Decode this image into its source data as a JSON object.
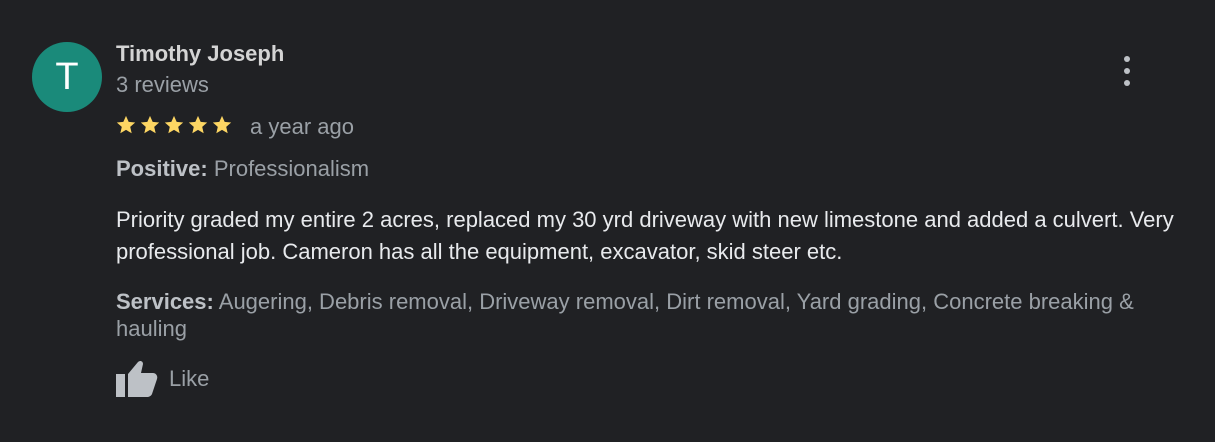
{
  "review": {
    "avatar_initial": "T",
    "avatar_color": "#1a8a7a",
    "reviewer_name": "Timothy Joseph",
    "review_count": "3 reviews",
    "rating": 5,
    "rating_max": 5,
    "star_color": "#fdd663",
    "time_ago": "a year ago",
    "positive_label": "Positive:",
    "positive_value": "Professionalism",
    "text": "Priority graded my entire 2 acres, replaced my 30 yrd driveway with new limestone and added a culvert. Very professional job. Cameron has all the equipment, excavator, skid steer etc.",
    "services_label": "Services:",
    "services_value": "Augering, Debris removal, Driveway removal, Dirt removal, Yard grading, Concrete breaking & hauling",
    "like_label": "Like",
    "more_icon": "more-vertical-icon",
    "like_icon": "thumbs-up-icon"
  }
}
